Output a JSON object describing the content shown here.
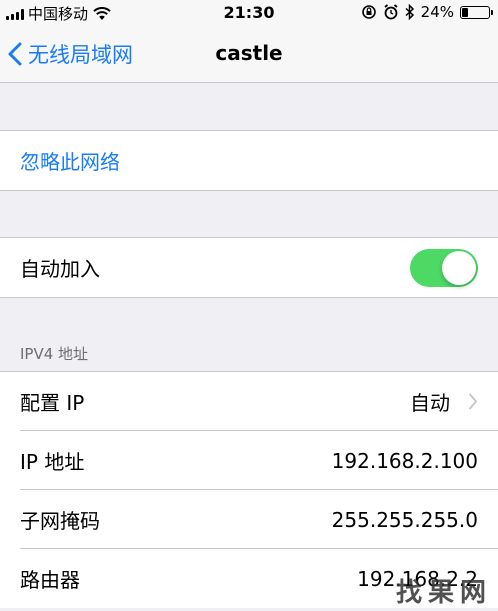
{
  "status_bar": {
    "carrier": "中国移动",
    "time": "21:30",
    "battery_percent": "24%",
    "battery_level": 0.24,
    "icons": [
      "signal-icon",
      "wifi-icon",
      "orientation-lock-icon",
      "alarm-icon",
      "bluetooth-icon",
      "battery-icon"
    ]
  },
  "nav": {
    "back_label": "无线局域网",
    "title": "castle"
  },
  "forget": {
    "label": "忽略此网络"
  },
  "auto_join": {
    "label": "自动加入",
    "enabled": true
  },
  "ipv4": {
    "header": "IPV4 地址",
    "rows": [
      {
        "label": "配置 IP",
        "value": "自动"
      },
      {
        "label": "IP 地址",
        "value": "192.168.2.100"
      },
      {
        "label": "子网掩码",
        "value": "255.255.255.0"
      },
      {
        "label": "路由器",
        "value": "192.168.2.2"
      }
    ]
  },
  "watermark": "找果网",
  "colors": {
    "accent": "#1a7cf5",
    "toggle_on": "#4cd964",
    "background": "#efeff4"
  }
}
